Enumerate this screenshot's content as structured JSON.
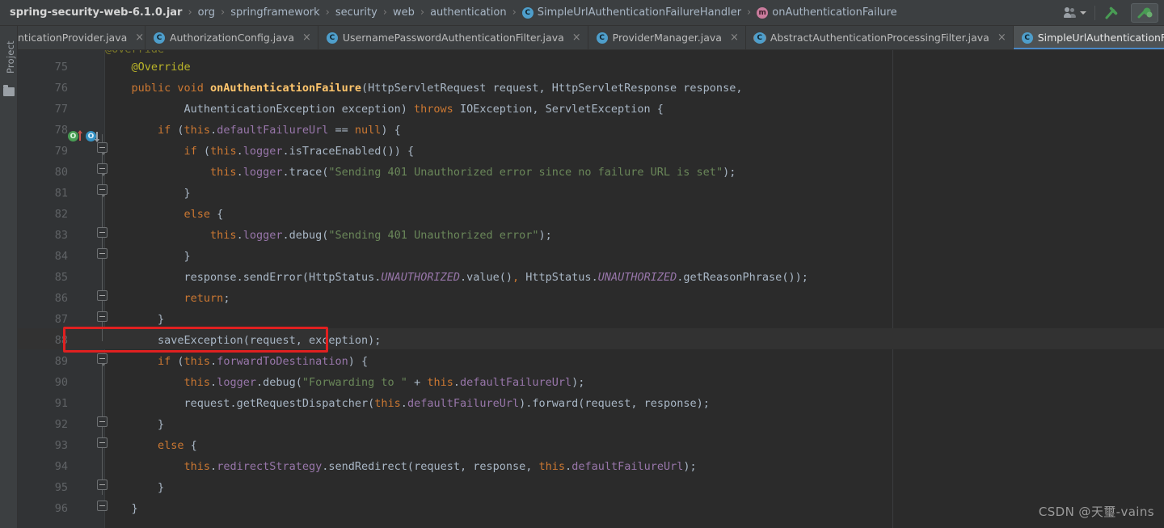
{
  "window": {
    "breadcrumb": {
      "root": "spring-security-web-6.1.0.jar",
      "separator": "›",
      "items": [
        {
          "label": "org",
          "icon": ""
        },
        {
          "label": "springframework",
          "icon": ""
        },
        {
          "label": "security",
          "icon": ""
        },
        {
          "label": "web",
          "icon": ""
        },
        {
          "label": "authentication",
          "icon": ""
        },
        {
          "label": "SimpleUrlAuthenticationFailureHandler",
          "icon": "class-icon",
          "badge": "C"
        },
        {
          "label": "onAuthenticationFailure",
          "icon": "method-icon",
          "badge": "m"
        }
      ]
    },
    "toolbar_right": {
      "people_icon": "people-icon",
      "caret_icon": "chevron-down-icon",
      "build_icon": "hammer-build-icon",
      "run_settings_icon": "run-with-coverage-icon"
    }
  },
  "left_strip": {
    "project_label": "Project",
    "folder_icon": "folder-icon"
  },
  "tabs": [
    {
      "label": "nticationProvider.java",
      "icon": "",
      "clipped": true,
      "active": false,
      "close": "×"
    },
    {
      "label": "AuthorizationConfig.java",
      "icon": "class-icon",
      "badge": "C",
      "clipped": false,
      "active": false,
      "close": "×"
    },
    {
      "label": "UsernamePasswordAuthenticationFilter.java",
      "icon": "class-icon",
      "badge": "C",
      "clipped": false,
      "active": false,
      "close": "×"
    },
    {
      "label": "ProviderManager.java",
      "icon": "class-icon",
      "badge": "C",
      "clipped": false,
      "active": false,
      "close": "×"
    },
    {
      "label": "AbstractAuthenticationProcessingFilter.java",
      "icon": "abstract-class-icon",
      "badge": "C",
      "clipped": false,
      "active": false,
      "close": "×"
    },
    {
      "label": "SimpleUrlAuthenticationFailureHandler.java",
      "icon": "class-icon",
      "badge": "C",
      "clipped": false,
      "active": true,
      "close": "×"
    }
  ],
  "editor": {
    "clipped_top_line": "@Override",
    "first_line_number": 75,
    "current_line": 88,
    "gutter_markers": {
      "line": 76,
      "implements_icon": "implementing-method-icon",
      "implements_glyph": "O",
      "override_icon": "overriding-method-icon",
      "override_glyph": "O"
    },
    "annotation_box": {
      "line": 88,
      "color": "#e02020",
      "text": "saveException(request, exception);"
    },
    "lines": [
      {
        "n": 75,
        "text": ""
      },
      {
        "n": 76,
        "text": "    public void onAuthenticationFailure(HttpServletRequest request, HttpServletResponse response,"
      },
      {
        "n": 77,
        "text": "            AuthenticationException exception) throws IOException, ServletException {"
      },
      {
        "n": 78,
        "text": "        if (this.defaultFailureUrl == null) {"
      },
      {
        "n": 79,
        "text": "            if (this.logger.isTraceEnabled()) {"
      },
      {
        "n": 80,
        "text": "                this.logger.trace(\"Sending 401 Unauthorized error since no failure URL is set\");"
      },
      {
        "n": 81,
        "text": "            }"
      },
      {
        "n": 82,
        "text": "            else {"
      },
      {
        "n": 83,
        "text": "                this.logger.debug(\"Sending 401 Unauthorized error\");"
      },
      {
        "n": 84,
        "text": "            }"
      },
      {
        "n": 85,
        "text": "            response.sendError(HttpStatus.UNAUTHORIZED.value(), HttpStatus.UNAUTHORIZED.getReasonPhrase());"
      },
      {
        "n": 86,
        "text": "            return;"
      },
      {
        "n": 87,
        "text": "        }"
      },
      {
        "n": 88,
        "text": "        saveException(request, exception);"
      },
      {
        "n": 89,
        "text": "        if (this.forwardToDestination) {"
      },
      {
        "n": 90,
        "text": "            this.logger.debug(\"Forwarding to \" + this.defaultFailureUrl);"
      },
      {
        "n": 91,
        "text": "            request.getRequestDispatcher(this.defaultFailureUrl).forward(request, response);"
      },
      {
        "n": 92,
        "text": "        }"
      },
      {
        "n": 93,
        "text": "        else {"
      },
      {
        "n": 94,
        "text": "            this.redirectStrategy.sendRedirect(request, response, this.defaultFailureUrl);"
      },
      {
        "n": 95,
        "text": "        }"
      },
      {
        "n": 96,
        "text": "    }"
      }
    ],
    "colors": {
      "background": "#2b2b2b",
      "gutter": "#313335",
      "keyword": "#cc7832",
      "string": "#6a8759",
      "number": "#6897bb",
      "field": "#9876aa",
      "static_field": "#9876aa",
      "method_declaration": "#ffc66d",
      "annotation": "#bbb529",
      "identifier": "#a9b7c6",
      "line_number": "#606366",
      "current_line_bg": "#323232"
    }
  },
  "watermark": "CSDN @天璽-vains"
}
